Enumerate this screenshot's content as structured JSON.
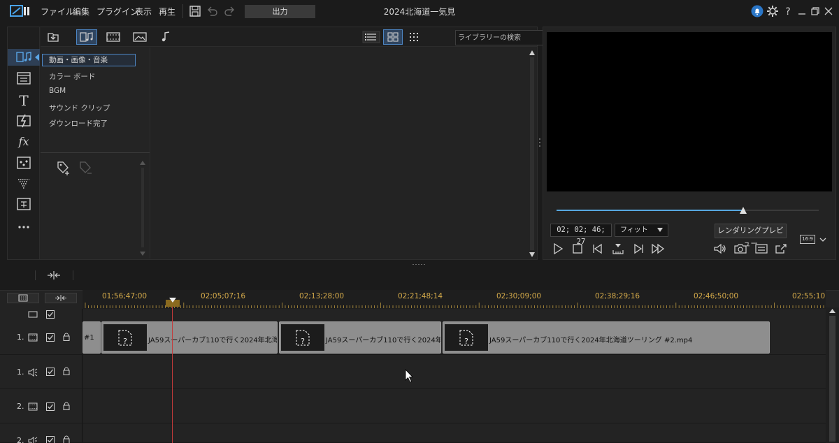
{
  "menu": {
    "items": [
      "ファイル",
      "編集",
      "プラグイン",
      "表示",
      "再生"
    ],
    "output_label": "出力",
    "project_title": "2024北海道一気見"
  },
  "library": {
    "search_placeholder": "ライブラリーの検索",
    "categories": [
      "動画・画像・音楽",
      "カラー ボード",
      "BGM",
      "サウンド クリップ",
      "ダウンロード完了"
    ],
    "selected_category_index": 0
  },
  "preview": {
    "timecode": "02; 02; 46; 27",
    "fit_label": "フィット",
    "render_preview_label": "レンダリングプレビュー",
    "aspect_label": "16:9",
    "scrub_position_fraction": 0.712
  },
  "timeline": {
    "ruler_labels": [
      "01;56;47;00",
      "02;05;07;16",
      "02;13;28;00",
      "02;21;48;14",
      "02;30;09;00",
      "02;38;29;16",
      "02;46;50;00",
      "02;55;10"
    ],
    "tracks": [
      {
        "num": "1.",
        "type": "video"
      },
      {
        "num": "1.",
        "type": "audio"
      },
      {
        "num": "2.",
        "type": "video"
      },
      {
        "num": "2.",
        "type": "audio"
      }
    ],
    "clips": [
      {
        "label": "#1"
      },
      {
        "label": "JA59スーパーカブ110で行く2024年北海"
      },
      {
        "label": "JA59スーパーカブ110で行く2024年"
      },
      {
        "label": "JA59スーパーカブ110で行く2024年北海道ツーリング  #2.mp4"
      }
    ]
  },
  "colors": {
    "accent": "#4d86c4",
    "ruler_text": "#d3a94a",
    "playhead": "#c43a3a",
    "scrub_fill": "#56a7e0"
  }
}
